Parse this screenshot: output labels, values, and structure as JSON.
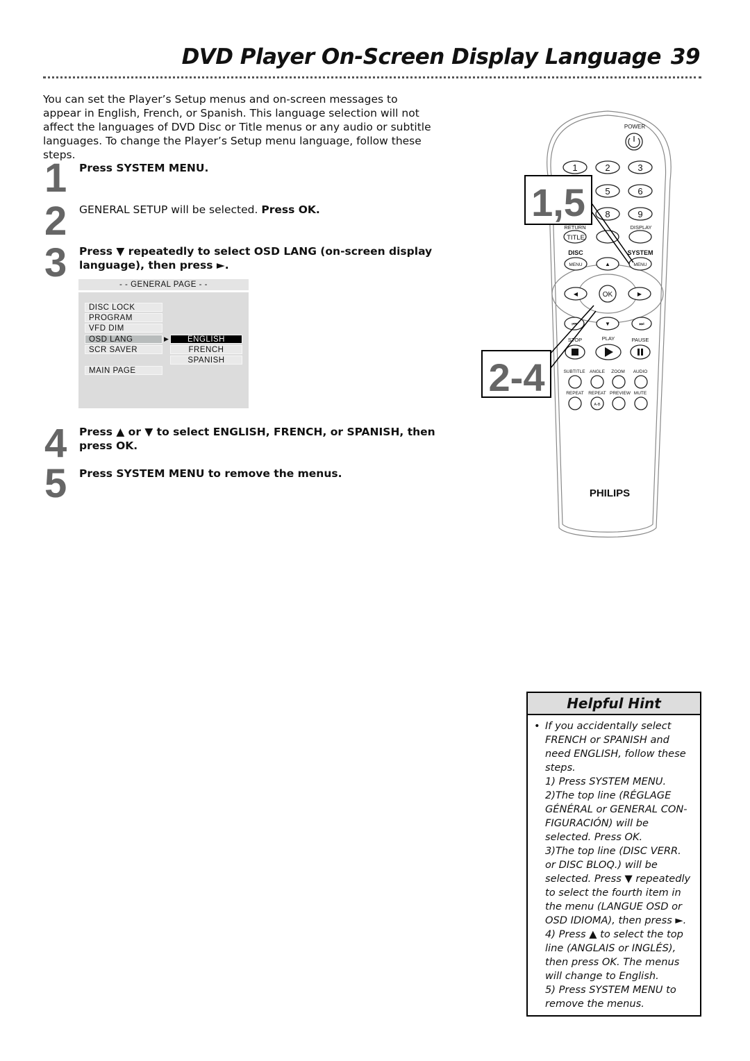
{
  "header": {
    "title": "DVD Player On-Screen Display Language",
    "page_number": "39"
  },
  "intro": "You can set the Player’s Setup menus and on-screen messages to appear in English, French, or Spanish. This language selection will not affect the languages of DVD Disc or Title menus or any audio or subtitle languages. To change the Player’s Setup menu language, follow these steps.",
  "steps": [
    {
      "number": "1",
      "bold": "Press SYSTEM MENU.",
      "plain": ""
    },
    {
      "number": "2",
      "plain": "GENERAL SETUP will be selected. ",
      "bold": "Press OK."
    },
    {
      "number": "3",
      "bold": "Press ▼ repeatedly to select OSD LANG (on-screen display language), then press ►."
    },
    {
      "number": "4",
      "bold": "Press ▲ or ▼ to select ENGLISH, FRENCH, or SPANISH, then press OK."
    },
    {
      "number": "5",
      "bold": "Press SYSTEM MENU to remove the menus."
    }
  ],
  "osd_menu": {
    "header": "- -  GENERAL PAGE  - -",
    "items": [
      "DISC LOCK",
      "PROGRAM",
      "VFD DIM",
      "OSD LANG",
      "SCR SAVER",
      "MAIN PAGE"
    ],
    "selected_item": "OSD LANG",
    "options": [
      "ENGLISH",
      "FRENCH",
      "SPANISH"
    ],
    "selected_option": "ENGLISH"
  },
  "remote": {
    "brand": "PHILIPS",
    "power": "POWER",
    "digits": [
      "1",
      "2",
      "3",
      "5",
      "6",
      "8",
      "9"
    ],
    "return": "RETURN",
    "display": "DISPLAY",
    "title": "TITLE",
    "disc": "DISC",
    "system": "SYSTEM",
    "menu": "MENU",
    "ok": "OK",
    "stop": "STOP",
    "play": "PLAY",
    "pause": "PAUSE",
    "subtitle": "SUBTITLE",
    "angle": "ANGLE",
    "zoom": "ZOOM",
    "audio": "AUDIO",
    "repeat": "REPEAT",
    "preview": "PREVIEW",
    "mute": "MUTE",
    "ab": "A-B",
    "callouts": [
      "1,5",
      "2-4"
    ]
  },
  "hint": {
    "title": "Helpful Hint",
    "bullet": "•",
    "lines": [
      "If you accidentally select FRENCH or SPANISH and need ENGLISH, follow these steps.",
      "1) Press SYSTEM MENU.",
      "2)The top line (RÉGLAGE GÉNÉRAL or GENERAL CON-FIGURACIÓN) will be selected. Press OK.",
      "3)The top line (DISC VERR. or DISC BLOQ.) will be selected. Press ▼ repeatedly to select the fourth item in the menu (LANGUE OSD or OSD IDIOMA), then press ►.",
      "4) Press ▲ to select the top line (ANGLAIS or INGLÉS), then press OK. The menus will change to English.",
      "5) Press SYSTEM MENU to remove the menus."
    ]
  }
}
